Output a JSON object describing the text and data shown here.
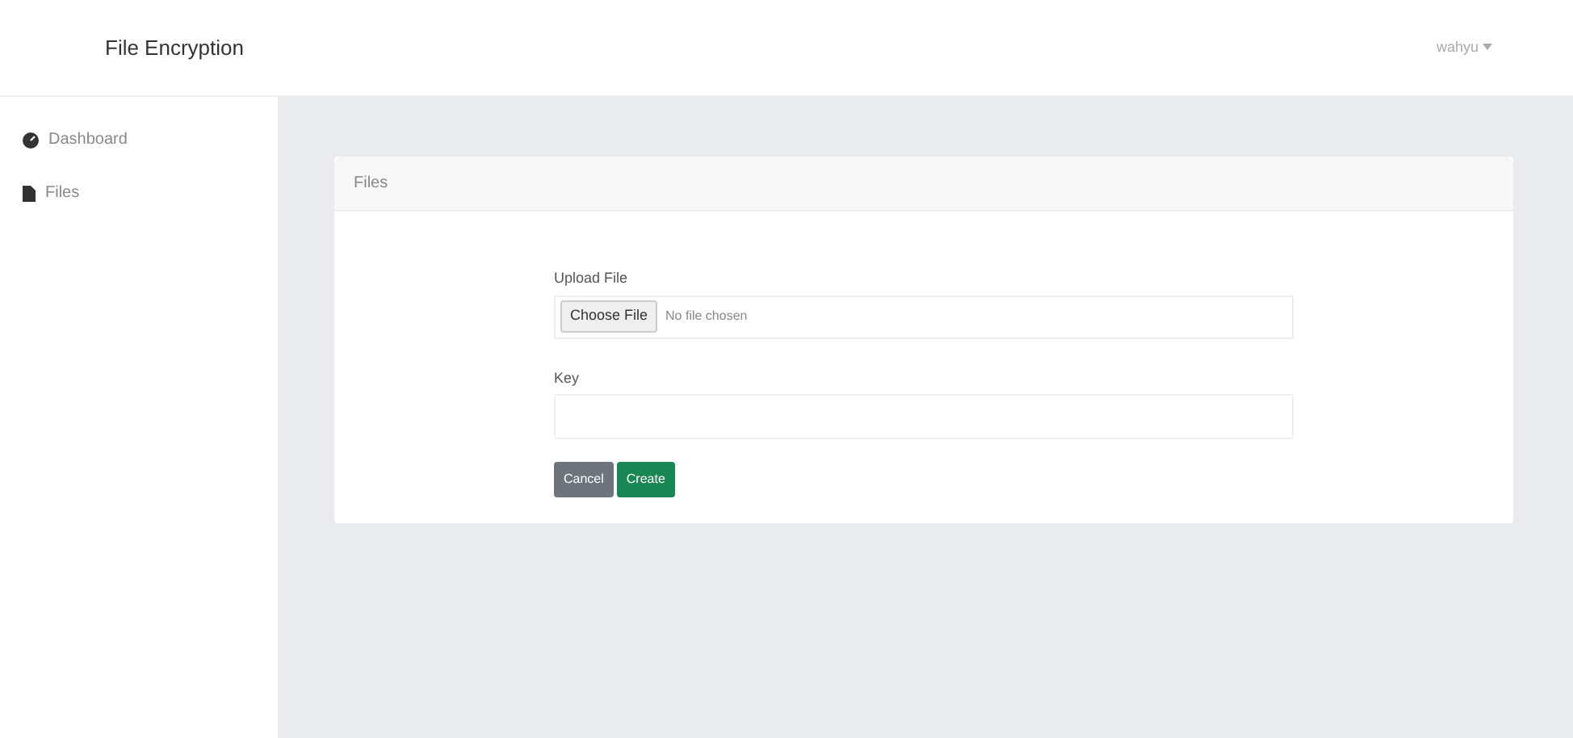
{
  "navbar": {
    "brand": "File Encryption",
    "user_menu": "wahyu"
  },
  "sidebar": {
    "items": [
      {
        "label": "Dashboard",
        "kind": "dashboard",
        "selected": false
      },
      {
        "label": "Files",
        "kind": "file",
        "selected": false
      }
    ]
  },
  "card": {
    "title": "Files",
    "form": {
      "file_label": "Upload File",
      "file_button": "Choose File",
      "file_status": "No file chosen",
      "key_label": "Key"
    },
    "buttons": [
      {
        "label": "Cancel",
        "kind": "secondary"
      },
      {
        "label": "Create",
        "kind": "success"
      }
    ]
  }
}
